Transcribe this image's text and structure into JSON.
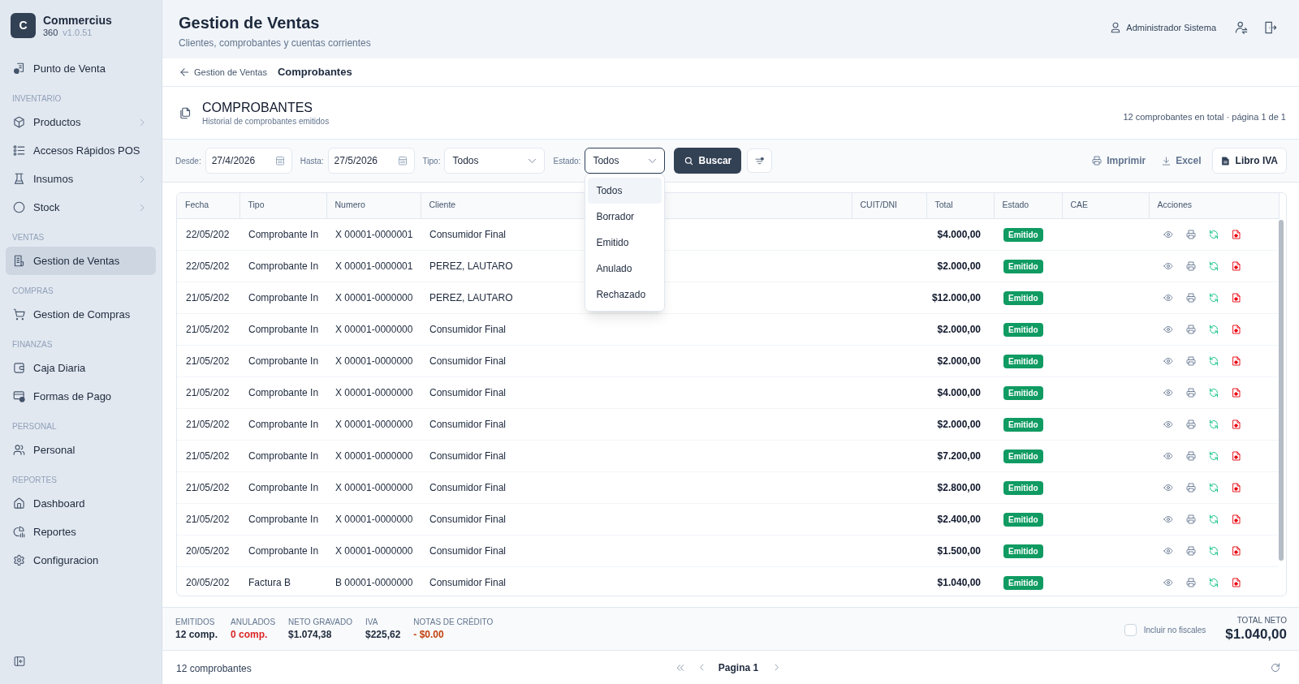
{
  "sidebar": {
    "brand": {
      "logo_letter": "C",
      "name": "Commercius",
      "edition": "360",
      "version": "v1.0.51"
    },
    "sections": [
      {
        "items": [
          {
            "label": "Punto de Venta",
            "kind": "link",
            "selected": false
          }
        ]
      },
      {
        "title": "INVENTARIO",
        "items": [
          {
            "label": "Productos",
            "kind": "group",
            "selected": false
          },
          {
            "label": "Accesos Rápidos POS",
            "kind": "link",
            "selected": false
          },
          {
            "label": "Insumos",
            "kind": "group",
            "selected": false
          },
          {
            "label": "Stock",
            "kind": "group",
            "selected": false
          }
        ]
      },
      {
        "title": "VENTAS",
        "items": [
          {
            "label": "Gestion de Ventas",
            "kind": "link",
            "selected": true
          }
        ]
      },
      {
        "title": "COMPRAS",
        "items": [
          {
            "label": "Gestion de Compras",
            "kind": "link",
            "selected": false
          }
        ]
      },
      {
        "title": "FINANZAS",
        "items": [
          {
            "label": "Caja Diaria",
            "kind": "link",
            "selected": false
          },
          {
            "label": "Formas de Pago",
            "kind": "link",
            "selected": false
          }
        ]
      },
      {
        "title": "PERSONAL",
        "items": [
          {
            "label": "Personal",
            "kind": "link",
            "selected": false
          }
        ]
      },
      {
        "title": "REPORTES",
        "items": [
          {
            "label": "Dashboard",
            "kind": "link",
            "selected": false
          },
          {
            "label": "Reportes",
            "kind": "link",
            "selected": false
          },
          {
            "label": "Configuracion",
            "kind": "link",
            "selected": false
          }
        ]
      }
    ]
  },
  "header": {
    "title": "Gestion de Ventas",
    "subtitle": "Clientes, comprobantes y cuentas corrientes",
    "user_name": "Administrador Sistema"
  },
  "breadcrumb": {
    "back_label": "Gestion de Ventas",
    "current": "Comprobantes"
  },
  "section": {
    "title": "COMPROBANTES",
    "subtitle": "Historial de comprobantes emitidos",
    "summary": "12 comprobantes en total · página 1 de 1"
  },
  "filters": [
    {
      "label": "Desde:",
      "kind": "date",
      "value": "27/4/2026"
    },
    {
      "label": "Hasta:",
      "kind": "date",
      "value": "27/5/2026"
    },
    {
      "label": "Tipo:",
      "kind": "select",
      "value": "Todos",
      "expanded": false
    },
    {
      "label": "Estado:",
      "kind": "select",
      "value": "Todos",
      "expanded": true,
      "options": [
        {
          "label": "Todos",
          "selected": true
        },
        {
          "label": "Borrador",
          "selected": false
        },
        {
          "label": "Emitido",
          "selected": false
        },
        {
          "label": "Anulado",
          "selected": false
        },
        {
          "label": "Rechazado",
          "selected": false
        }
      ]
    }
  ],
  "search_button": {
    "label": "Buscar"
  },
  "export_actions": [
    {
      "label": "Imprimir",
      "kind": "print"
    },
    {
      "label": "Excel",
      "kind": "download"
    },
    {
      "label": "Libro IVA",
      "kind": "report"
    }
  ],
  "table": {
    "columns": [
      "Fecha",
      "Tipo",
      "Numero",
      "Cliente",
      "CUIT/DNI",
      "Total",
      "Estado",
      "CAE",
      "Acciones"
    ],
    "rows": [
      {
        "fecha": "22/05/202",
        "tipo": "Comprobante In",
        "numero": "X 00001-0000001",
        "cliente": "Consumidor Final",
        "total": "$4.000,00",
        "estado": "Emitido"
      },
      {
        "fecha": "22/05/202",
        "tipo": "Comprobante In",
        "numero": "X 00001-0000001",
        "cliente": "PEREZ, LAUTARO",
        "total": "$2.000,00",
        "estado": "Emitido"
      },
      {
        "fecha": "21/05/202",
        "tipo": "Comprobante In",
        "numero": "X 00001-0000000",
        "cliente": "PEREZ, LAUTARO",
        "total": "$12.000,00",
        "estado": "Emitido"
      },
      {
        "fecha": "21/05/202",
        "tipo": "Comprobante In",
        "numero": "X 00001-0000000",
        "cliente": "Consumidor Final",
        "total": "$2.000,00",
        "estado": "Emitido"
      },
      {
        "fecha": "21/05/202",
        "tipo": "Comprobante In",
        "numero": "X 00001-0000000",
        "cliente": "Consumidor Final",
        "total": "$2.000,00",
        "estado": "Emitido"
      },
      {
        "fecha": "21/05/202",
        "tipo": "Comprobante In",
        "numero": "X 00001-0000000",
        "cliente": "Consumidor Final",
        "total": "$4.000,00",
        "estado": "Emitido"
      },
      {
        "fecha": "21/05/202",
        "tipo": "Comprobante In",
        "numero": "X 00001-0000000",
        "cliente": "Consumidor Final",
        "total": "$2.000,00",
        "estado": "Emitido"
      },
      {
        "fecha": "21/05/202",
        "tipo": "Comprobante In",
        "numero": "X 00001-0000000",
        "cliente": "Consumidor Final",
        "total": "$7.200,00",
        "estado": "Emitido"
      },
      {
        "fecha": "21/05/202",
        "tipo": "Comprobante In",
        "numero": "X 00001-0000000",
        "cliente": "Consumidor Final",
        "total": "$2.800,00",
        "estado": "Emitido"
      },
      {
        "fecha": "21/05/202",
        "tipo": "Comprobante In",
        "numero": "X 00001-0000000",
        "cliente": "Consumidor Final",
        "total": "$2.400,00",
        "estado": "Emitido"
      },
      {
        "fecha": "20/05/202",
        "tipo": "Comprobante In",
        "numero": "X 00001-0000000",
        "cliente": "Consumidor Final",
        "total": "$1.500,00",
        "estado": "Emitido"
      },
      {
        "fecha": "20/05/202",
        "tipo": "Factura B",
        "numero": "B 00001-0000000",
        "cliente": "Consumidor Final",
        "total": "$1.040,00",
        "estado": "Emitido"
      }
    ]
  },
  "summary": {
    "stats": [
      {
        "label": "EMITIDOS",
        "value": "12 comp.",
        "color": "#1e293b"
      },
      {
        "label": "ANULADOS",
        "value": "0 comp.",
        "color": "#dc2626"
      },
      {
        "label": "NETO GRAVADO",
        "value": "$1.074,38",
        "color": "#1e293b"
      },
      {
        "label": "IVA",
        "value": "$225,62",
        "color": "#1e293b"
      },
      {
        "label": "NOTAS DE CRÉDITO",
        "value": "- $0.00",
        "color": "#c2410c"
      }
    ],
    "include_non_fiscal": {
      "label": "Incluir no fiscales",
      "checked": false
    },
    "total": {
      "label": "TOTAL NETO",
      "value": "$1.040,00"
    }
  },
  "footer": {
    "count": "12 comprobantes",
    "page": "Pagina 1"
  }
}
